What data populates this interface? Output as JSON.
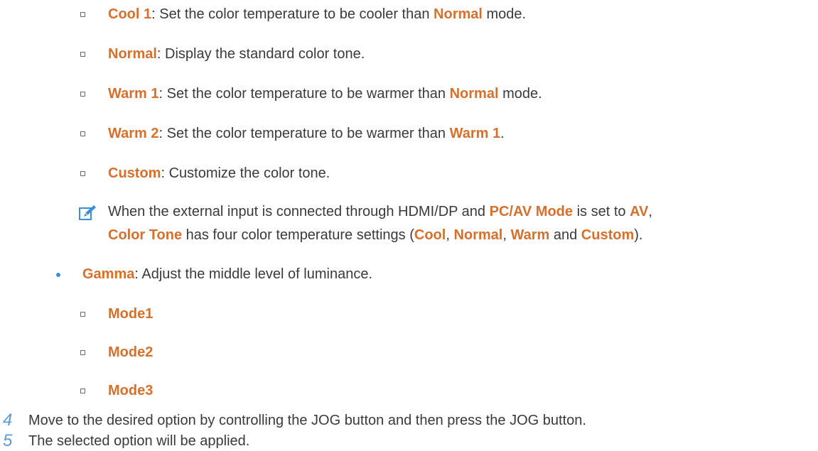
{
  "color_tone_items": [
    {
      "term": "Cool 1",
      "text": ": Set the color temperature to be cooler than ",
      "term2": "Normal",
      "text2": " mode."
    },
    {
      "term": "Normal",
      "text": ": Display the standard color tone."
    },
    {
      "term": "Warm 1",
      "text": ": Set the color temperature to be warmer than ",
      "term2": "Normal",
      "text2": " mode."
    },
    {
      "term": "Warm 2",
      "text": ": Set the color temperature to be warmer than ",
      "term2": "Warm 1",
      "text2": "."
    },
    {
      "term": "Custom",
      "text": ": Customize the color tone."
    }
  ],
  "note": {
    "icon": "note-pencil-icon",
    "l1_a": "When the external input is connected through HDMI/DP and ",
    "l1_b": "PC/AV Mode",
    "l1_c": " is set to ",
    "l1_d": "AV",
    "l1_e": ",",
    "l2_a": "Color Tone",
    "l2_b": " has four color temperature settings (",
    "l2_c": "Cool",
    "l2_d": ", ",
    "l2_e": "Normal",
    "l2_f": ", ",
    "l2_g": "Warm",
    "l2_h": " and ",
    "l2_i": "Custom",
    "l2_j": ")."
  },
  "gamma": {
    "term": "Gamma",
    "text": ": Adjust the middle level of luminance.",
    "modes": [
      "Mode1",
      "Mode2",
      "Mode3"
    ]
  },
  "steps": [
    {
      "num": "4",
      "text": "Move to the desired option by controlling the JOG button and then press the JOG button."
    },
    {
      "num": "5",
      "text": "The selected option will be applied."
    }
  ],
  "colors": {
    "highlight": "#d6702b",
    "step_number": "#5b9bd5",
    "bullet_dot": "#3a8fd6",
    "body_text": "#3a3a3a"
  }
}
